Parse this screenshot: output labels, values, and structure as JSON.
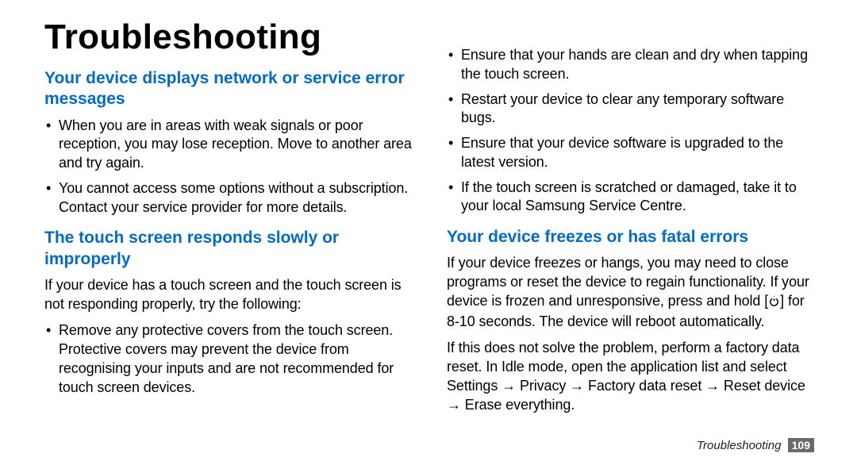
{
  "title": "Troubleshooting",
  "left": {
    "section1": {
      "heading": "Your device displays network or service error messages",
      "items": [
        "When you are in areas with weak signals or poor reception, you may lose reception. Move to another area and try again.",
        "You cannot access some options without a subscription. Contact your service provider for more details."
      ]
    },
    "section2": {
      "heading": "The touch screen responds slowly or improperly",
      "intro": "If your device has a touch screen and the touch screen is not responding properly, try the following:",
      "items": [
        "Remove any protective covers from the touch screen. Protective covers may prevent the device from recognising your inputs and are not recommended for touch screen devices."
      ]
    }
  },
  "right": {
    "cont_items": [
      "Ensure that your hands are clean and dry when tapping the touch screen.",
      "Restart your device to clear any temporary software bugs.",
      "Ensure that your device software is upgraded to the latest version.",
      "If the touch screen is scratched or damaged, take it to your local Samsung Service Centre."
    ],
    "section3": {
      "heading": "Your device freezes or has fatal errors",
      "para1_a": "If your device freezes or hangs, you may need to close programs or reset the device to regain functionality. If your device is frozen and unresponsive, press and hold [",
      "para1_b": "] for 8-10 seconds. The device will reboot automatically.",
      "para2": "If this does not solve the problem, perform a factory data reset. In Idle mode, open the application list and select Settings → Privacy → Factory data reset → Reset device → Erase everything."
    }
  },
  "footer_label": "Troubleshooting",
  "page_number": "109"
}
